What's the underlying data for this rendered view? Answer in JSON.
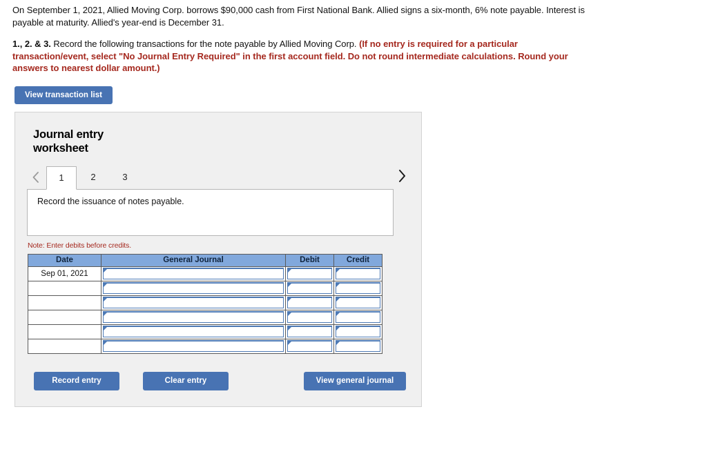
{
  "problem": {
    "stem": "On September 1, 2021, Allied Moving Corp. borrows $90,000 cash from First National Bank. Allied signs a six-month, 6% note payable. Interest is payable at maturity. Allied's year-end is December 31.",
    "requirement_number": "1., 2. & 3.",
    "requirement_text": " Record the following transactions for the note payable by Allied Moving Corp. ",
    "requirement_note": "(If no entry is required for a particular transaction/event, select \"No Journal Entry Required\" in the first account field. Do not round intermediate calculations. Round your answers to nearest dollar amount.)"
  },
  "toolbar": {
    "view_transaction_list_label": "View transaction list"
  },
  "worksheet": {
    "title": "Journal entry worksheet",
    "tabs": [
      {
        "label": "1",
        "active": true
      },
      {
        "label": "2",
        "active": false
      },
      {
        "label": "3",
        "active": false
      }
    ],
    "prev_icon": "chevron-left-icon",
    "next_icon": "chevron-right-icon",
    "instruction": "Record the issuance of notes payable.",
    "debits_note": "Note: Enter debits before credits.",
    "table": {
      "columns": [
        "Date",
        "General Journal",
        "Debit",
        "Credit"
      ],
      "rows": [
        {
          "date": "Sep 01, 2021",
          "general_journal": "",
          "debit": "",
          "credit": ""
        },
        {
          "date": "",
          "general_journal": "",
          "debit": "",
          "credit": ""
        },
        {
          "date": "",
          "general_journal": "",
          "debit": "",
          "credit": ""
        },
        {
          "date": "",
          "general_journal": "",
          "debit": "",
          "credit": ""
        },
        {
          "date": "",
          "general_journal": "",
          "debit": "",
          "credit": ""
        },
        {
          "date": "",
          "general_journal": "",
          "debit": "",
          "credit": ""
        }
      ]
    },
    "actions": {
      "record_entry_label": "Record entry",
      "clear_entry_label": "Clear entry",
      "view_general_journal_label": "View general journal"
    }
  },
  "colors": {
    "button_blue": "#4873b3",
    "table_header_blue": "#81a8dc",
    "warning_red": "#a5291f",
    "panel_gray": "#f0f0f0",
    "input_border_blue": "#4e7ab5"
  }
}
